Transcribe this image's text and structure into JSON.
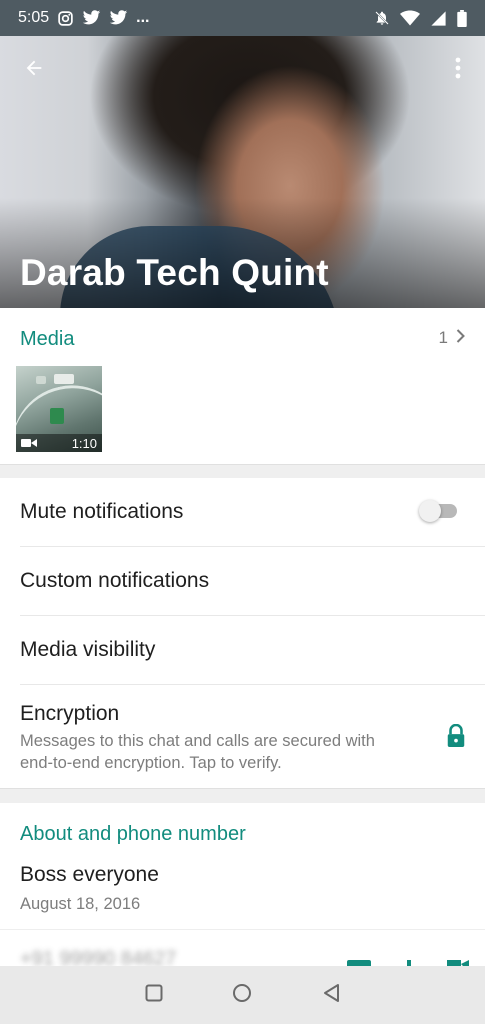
{
  "status_bar": {
    "time": "5:05",
    "more_label": "...",
    "icons": [
      "instagram-icon",
      "twitter-icon",
      "twitter-icon",
      "mute-notifications-icon",
      "wifi-icon",
      "signal-icon",
      "battery-icon"
    ]
  },
  "header": {
    "contact_name": "Darab Tech Quint",
    "back_icon": "arrow-back-icon",
    "menu_icon": "more-vert-icon"
  },
  "media": {
    "title": "Media",
    "count": "1",
    "items": [
      {
        "type": "video",
        "duration": "1:10"
      }
    ]
  },
  "settings": {
    "mute_label": "Mute notifications",
    "mute_enabled": false,
    "custom_label": "Custom notifications",
    "visibility_label": "Media visibility",
    "encryption_label": "Encryption",
    "encryption_desc": "Messages to this chat and calls are secured with end-to-end encryption. Tap to verify."
  },
  "about": {
    "title": "About and phone number",
    "status_text": "Boss everyone",
    "status_date": "August 18, 2016",
    "phone_blurred": "+91 99990 84627"
  },
  "colors": {
    "accent": "#128c7e",
    "status_bar": "#4f5b62"
  }
}
